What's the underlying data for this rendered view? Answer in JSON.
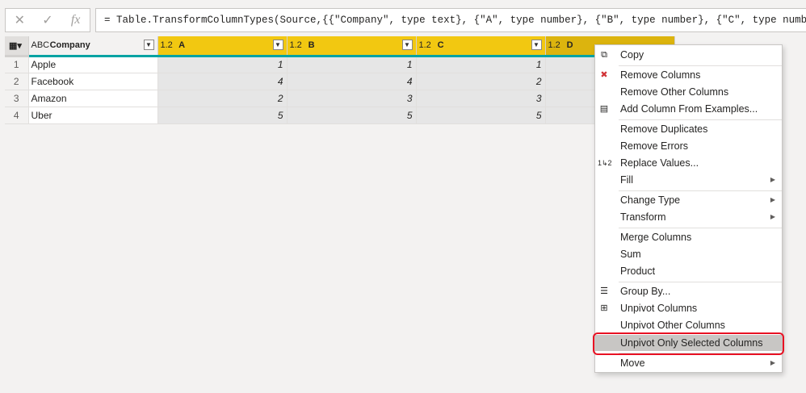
{
  "formula_bar": {
    "cancel_icon": "close-icon",
    "commit_icon": "check-icon",
    "fx_label": "fx",
    "formula": "= Table.TransformColumnTypes(Source,{{\"Company\", type text}, {\"A\", type number}, {\"B\", type number}, {\"C\", type number}, {\"D\","
  },
  "grid": {
    "columns": [
      {
        "type": "ABC",
        "name": "Company"
      },
      {
        "type": "1.2",
        "name": "A"
      },
      {
        "type": "1.2",
        "name": "B"
      },
      {
        "type": "1.2",
        "name": "C"
      },
      {
        "type": "1.2",
        "name": "D"
      }
    ],
    "rows": [
      {
        "n": "1",
        "company": "Apple",
        "a": "1",
        "b": "1",
        "c": "1"
      },
      {
        "n": "2",
        "company": "Facebook",
        "a": "4",
        "b": "4",
        "c": "2"
      },
      {
        "n": "3",
        "company": "Amazon",
        "a": "2",
        "b": "3",
        "c": "3"
      },
      {
        "n": "4",
        "company": "Uber",
        "a": "5",
        "b": "5",
        "c": "5"
      }
    ],
    "header_accent": "#f2c811",
    "quality_bar": "#00a3a3"
  },
  "menu": {
    "items": [
      {
        "label": "Copy",
        "icon": "copy-icon"
      },
      {
        "label": "Remove Columns",
        "icon": "remove-columns-icon"
      },
      {
        "label": "Remove Other Columns"
      },
      {
        "label": "Add Column From Examples...",
        "icon": "add-column-examples-icon"
      },
      {
        "label": "Remove Duplicates"
      },
      {
        "label": "Remove Errors"
      },
      {
        "label": "Replace Values...",
        "icon": "replace-values-icon"
      },
      {
        "label": "Fill"
      },
      {
        "label": "Change Type"
      },
      {
        "label": "Transform"
      },
      {
        "label": "Merge Columns"
      },
      {
        "label": "Sum"
      },
      {
        "label": "Product"
      },
      {
        "label": "Group By...",
        "icon": "group-by-icon"
      },
      {
        "label": "Unpivot Columns",
        "icon": "unpivot-icon"
      },
      {
        "label": "Unpivot Other Columns"
      },
      {
        "label": "Unpivot Only Selected Columns"
      },
      {
        "label": "Move"
      }
    ],
    "highlight_color": "#e81123"
  }
}
